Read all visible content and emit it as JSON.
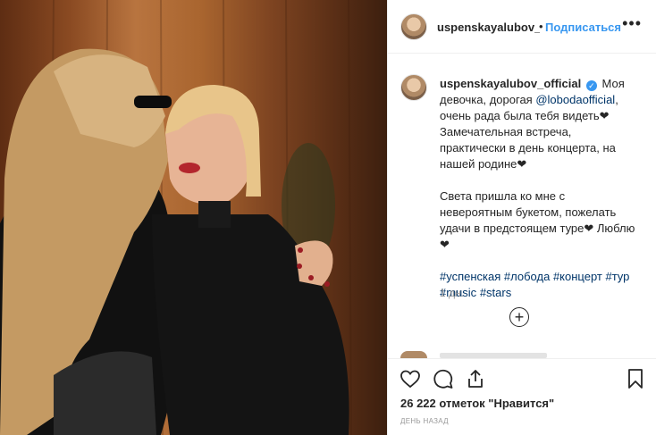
{
  "header": {
    "username": "uspenskayalubov_official",
    "separator": "•",
    "follow_label": "Подписаться",
    "more_icon": "more-horizontal-icon"
  },
  "caption": {
    "username": "uspenskayalubov_official",
    "verified_icon": "verified-badge-icon",
    "text_1_before_mention": "Моя девочка, дорогая ",
    "mention": "@lobodaofficial",
    "text_1_after_mention": ", очень рада была тебя видеть❤ Замечательная встреча, практически в день концерта, на нашей родине❤",
    "text_2": "Света пришла ко мне с невероятным букетом, пожелать удачи в предстоящем туре❤ Люблю❤",
    "hashtags": [
      "#успенская",
      "#лобода",
      "#концерт",
      "#тур",
      "#music",
      "#stars"
    ],
    "time": "1 дн."
  },
  "load_more_icon": "plus-circle-icon",
  "actions": {
    "like_icon": "heart-icon",
    "comment_icon": "comment-icon",
    "share_icon": "share-icon",
    "save_icon": "bookmark-icon",
    "likes_text": "26 222 отметок \"Нравится\"",
    "date_text": "день назад"
  },
  "colors": {
    "accent": "#3897f0",
    "link": "#003569",
    "muted": "#999999",
    "text": "#262626"
  }
}
